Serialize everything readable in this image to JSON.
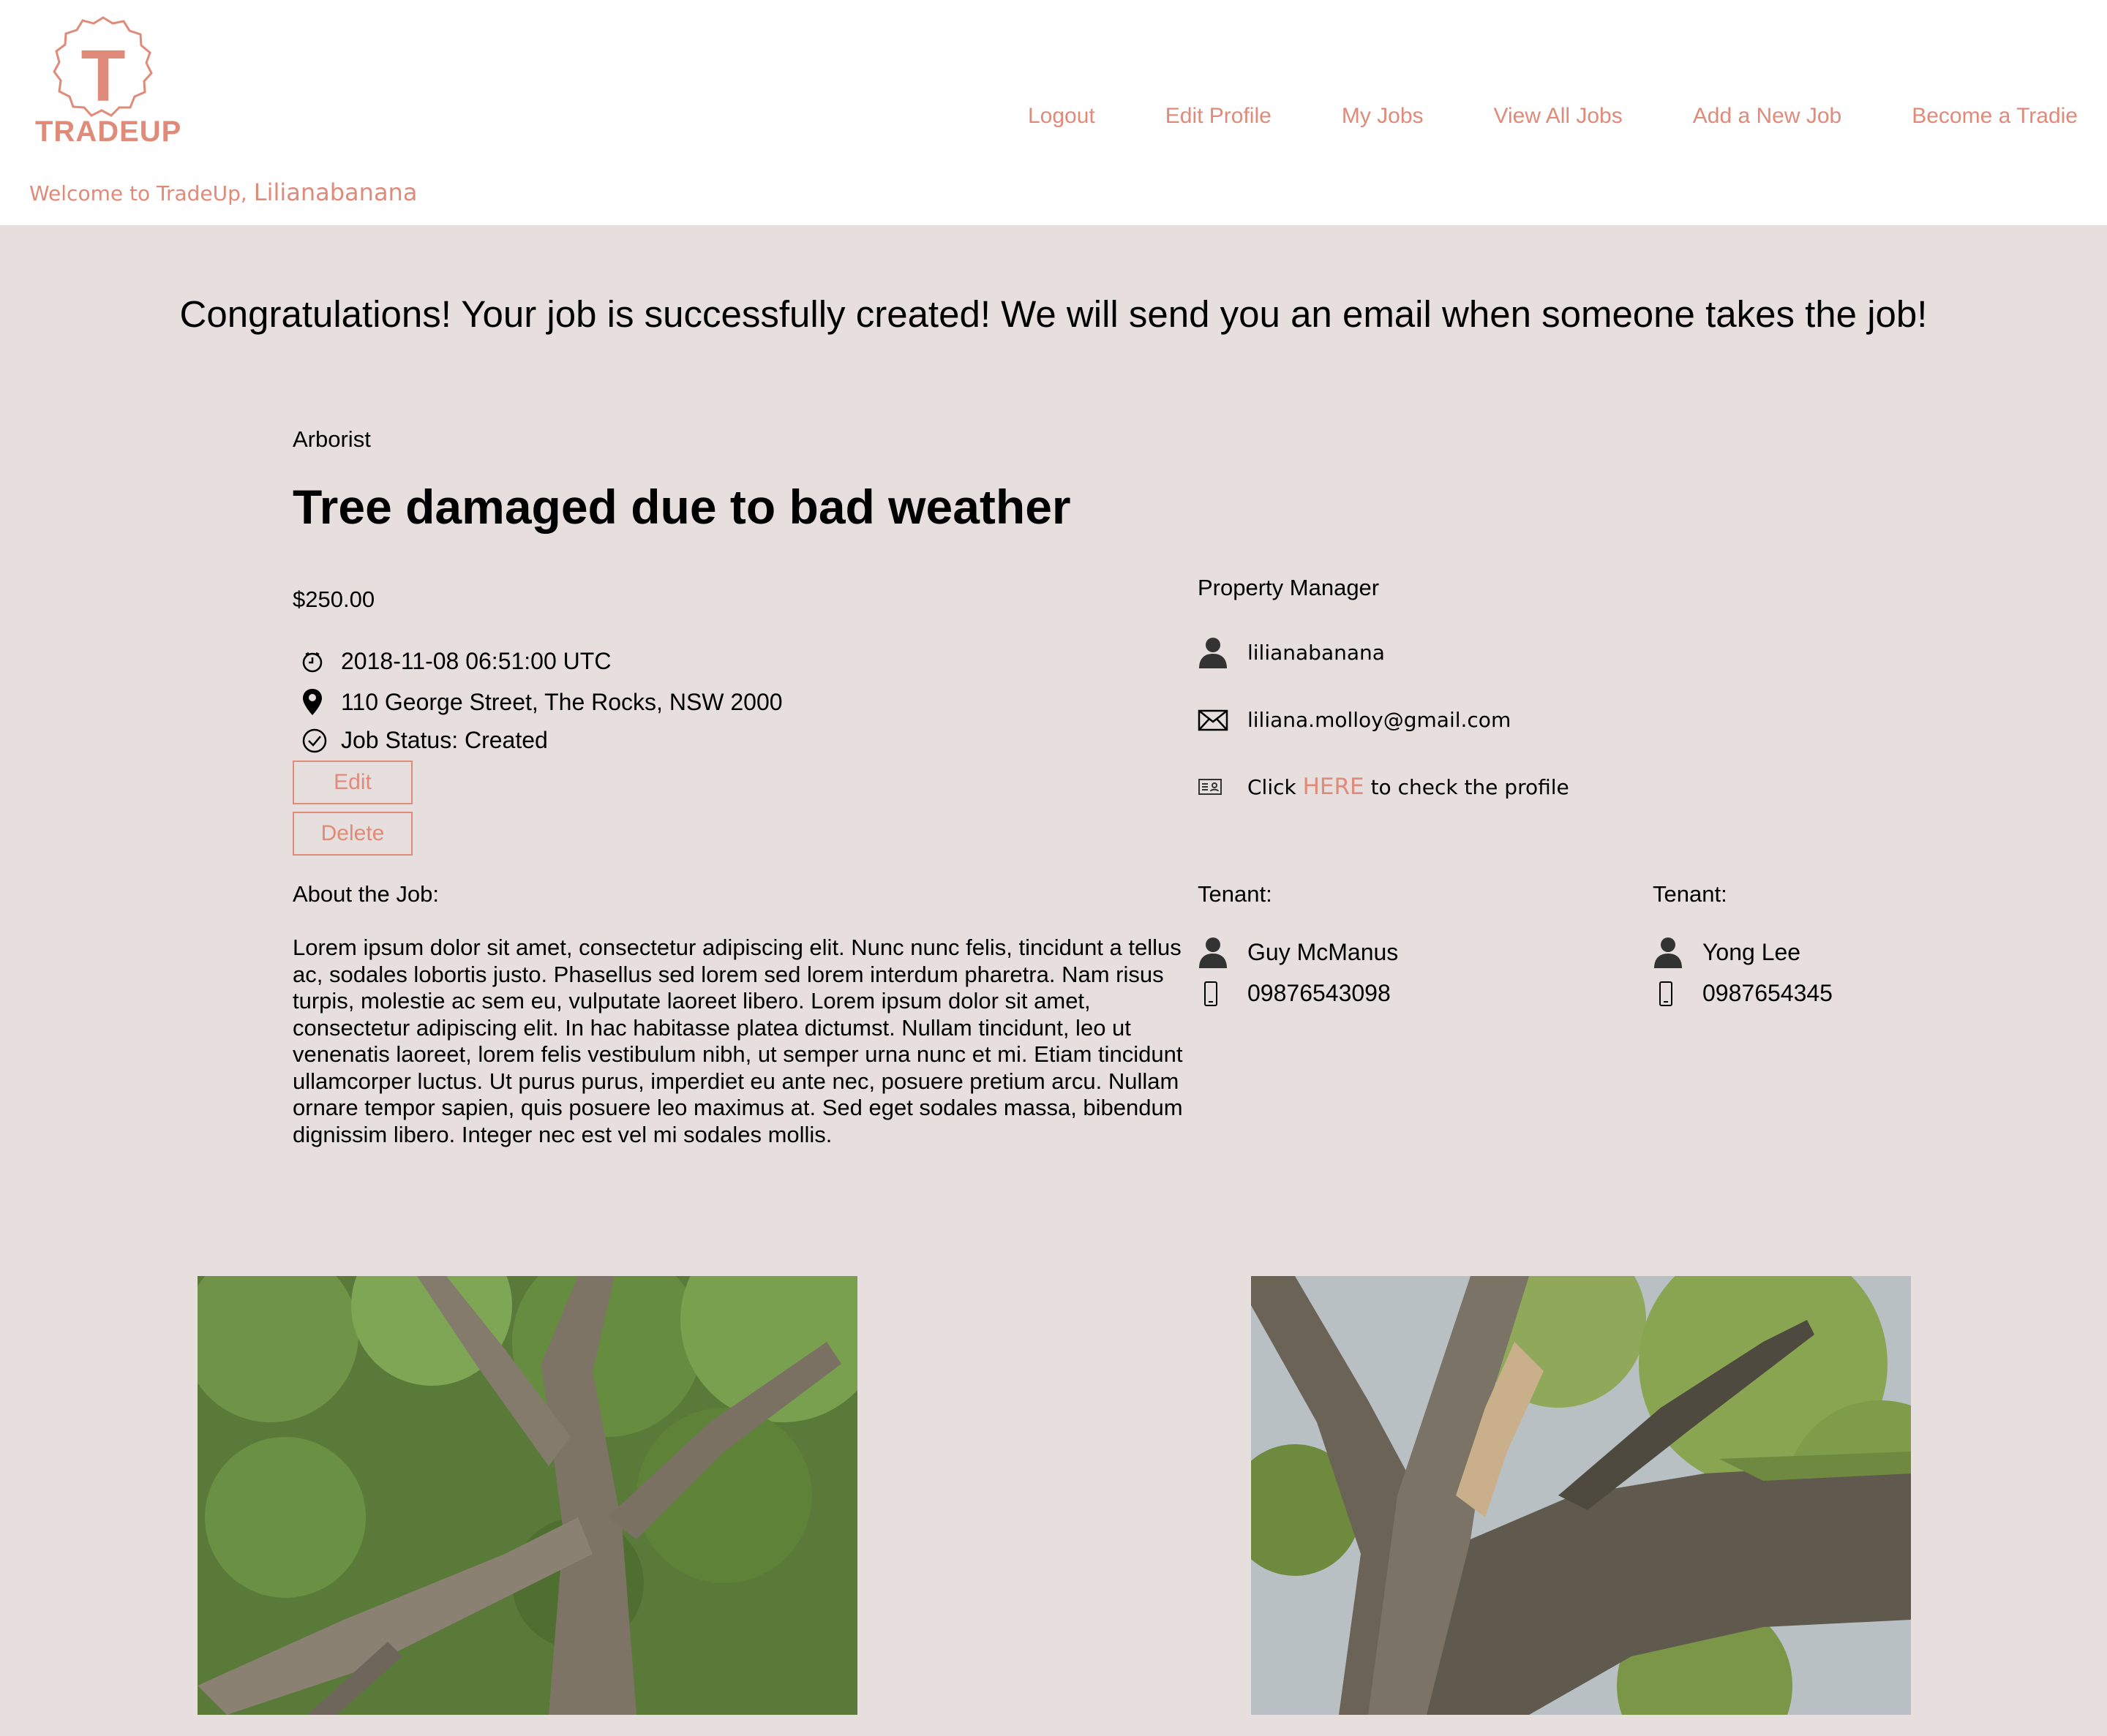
{
  "brand": {
    "logo_letter": "T",
    "name": "TRADEUP",
    "color": "#e08a7a"
  },
  "header": {
    "welcome_prefix": "Welcome to TradeUp,",
    "username": "Lilianabanana"
  },
  "nav": {
    "items": [
      {
        "label": "Logout"
      },
      {
        "label": "Edit Profile"
      },
      {
        "label": "My Jobs"
      },
      {
        "label": "View All Jobs"
      },
      {
        "label": "Add a New Job"
      },
      {
        "label": "Become a Tradie"
      }
    ]
  },
  "message": "Congratulations! Your job is successfully created! We will send you an email when someone takes the job!",
  "job": {
    "category": "Arborist",
    "title": "Tree damaged due to bad weather",
    "price": "$250.00",
    "datetime": "2018-11-08 06:51:00 UTC",
    "address": "110 George Street, The Rocks, NSW 2000",
    "status": "Job Status: Created",
    "edit_label": "Edit",
    "delete_label": "Delete",
    "about_label": "About the Job:",
    "about_text": "Lorem ipsum dolor sit amet, consectetur adipiscing elit. Nunc nunc felis, tincidunt a tellus ac, sodales lobortis justo. Phasellus sed lorem sed lorem interdum pharetra. Nam risus turpis, molestie ac sem eu, vulputate laoreet libero. Lorem ipsum dolor sit amet, consectetur adipiscing elit. In hac habitasse platea dictumst. Nullam tincidunt, leo ut venenatis laoreet, lorem felis vestibulum nibh, ut semper urna nunc et mi. Etiam tincidunt ullamcorper luctus. Ut purus purus, imperdiet eu ante nec, posuere pretium arcu. Nullam ornare tempor sapien, quis posuere leo maximus at. Sed eget sodales massa, bibendum dignissim libero. Integer nec est vel mi sodales mollis."
  },
  "property_manager": {
    "label": "Property Manager",
    "username": "lilianabanana",
    "email": "liliana.molloy@gmail.com",
    "profile_prefix": "Click",
    "profile_link": "HERE",
    "profile_suffix": "to check the profile"
  },
  "tenants": [
    {
      "label": "Tenant:",
      "name": "Guy McManus",
      "phone": "09876543098"
    },
    {
      "label": "Tenant:",
      "name": "Yong Lee",
      "phone": "0987654345"
    }
  ],
  "icons": {
    "clock": "clock-icon",
    "location": "location-pin-icon",
    "status": "check-circle-icon",
    "user": "user-icon",
    "email": "envelope-icon",
    "profile": "id-card-icon",
    "phone": "phone-icon"
  }
}
